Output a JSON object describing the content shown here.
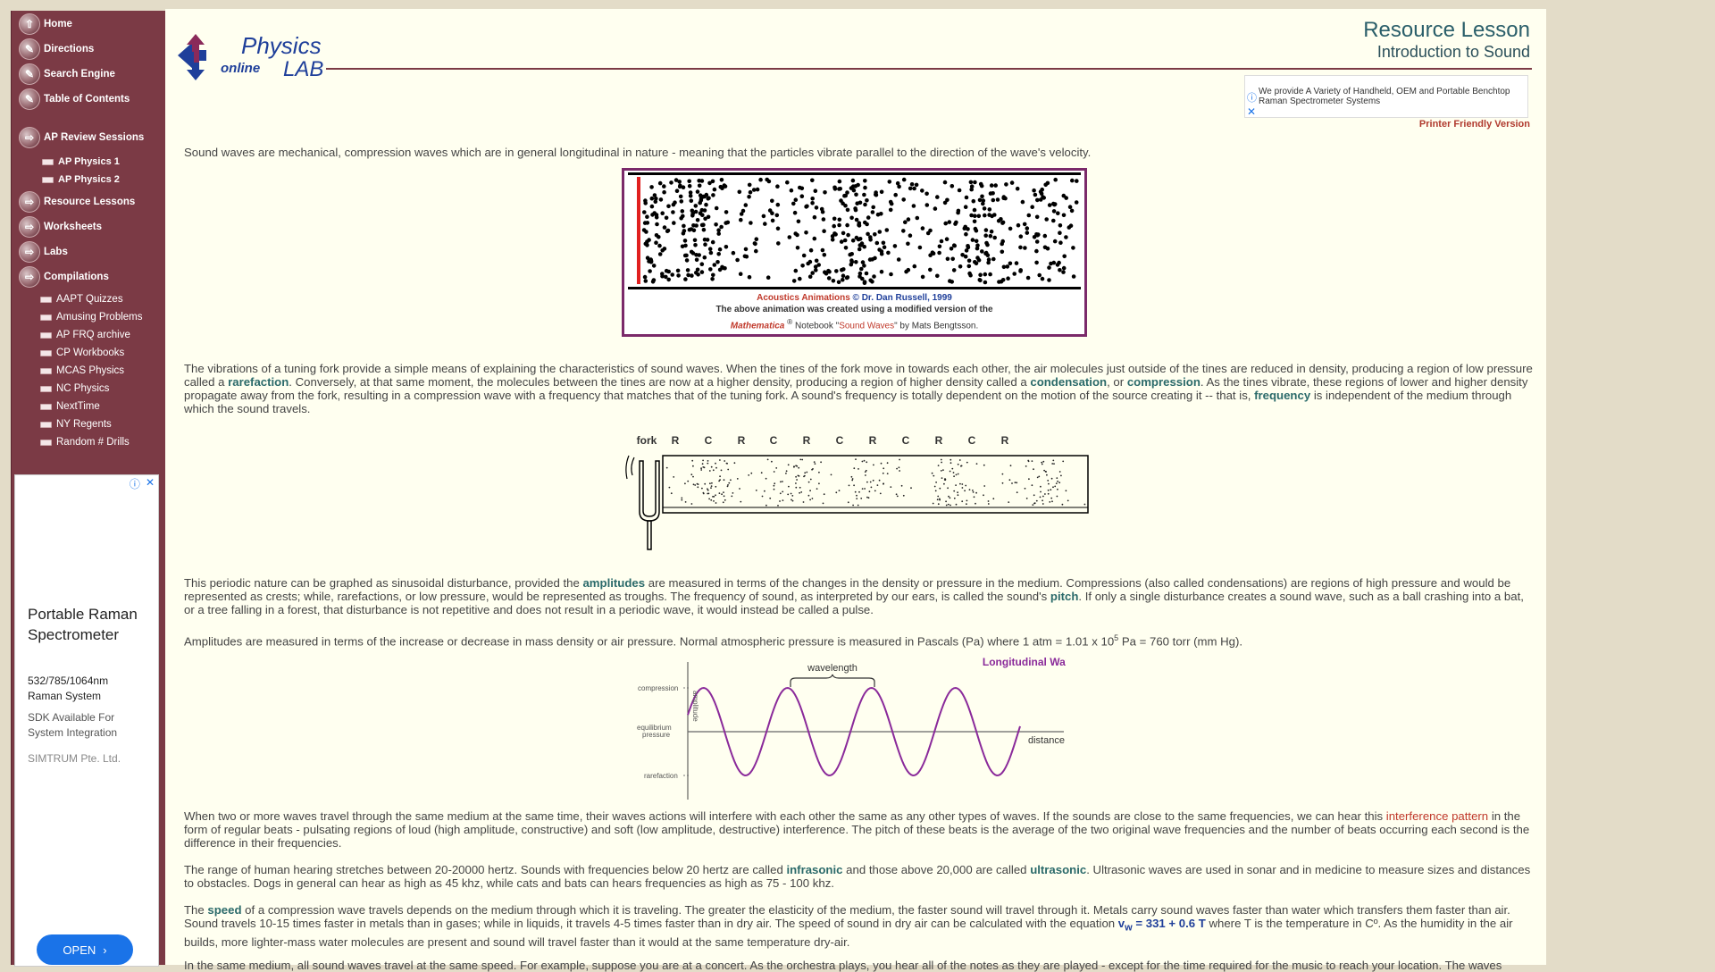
{
  "sidebar": {
    "nav": [
      {
        "label": "Home",
        "icon": "up-arrow-icon"
      },
      {
        "label": "Directions",
        "icon": "pencil-icon"
      },
      {
        "label": "Search Engine",
        "icon": "pencil-icon"
      },
      {
        "label": "Table of Contents",
        "icon": "pencil-icon"
      },
      {
        "label": "AP Review Sessions",
        "icon": "right-arrow-icon"
      },
      {
        "label": "Resource Lessons",
        "icon": "right-arrow-icon"
      },
      {
        "label": "Worksheets",
        "icon": "right-arrow-icon"
      },
      {
        "label": "Labs",
        "icon": "right-arrow-icon"
      },
      {
        "label": "Compilations",
        "icon": "right-arrow-icon"
      }
    ],
    "ap_sub": [
      "AP Physics 1",
      "AP Physics 2"
    ],
    "compilations_sub": [
      "AAPT Quizzes",
      "Amusing Problems",
      "AP FRQ archive",
      "CP Workbooks",
      "MCAS Physics",
      "NC Physics",
      "NextTime",
      "NY Regents",
      "Random # Drills"
    ]
  },
  "side_ad": {
    "title": "Portable Raman Spectrometer",
    "spec_line1": "532/785/1064nm",
    "spec_line2": "Raman System",
    "sdk_line1": "SDK Available For",
    "sdk_line2": "System Integration",
    "company": "SIMTRUM Pte. Ltd.",
    "button": "OPEN"
  },
  "header": {
    "logo_physics": "Physics",
    "logo_online": "online",
    "logo_lab": "LAB",
    "title": "Resource Lesson",
    "subtitle": "Introduction to Sound"
  },
  "top_ad": {
    "text": "We provide A Variety of Handheld, OEM and Portable Benchtop Raman Spectrometer Systems"
  },
  "printer_link": "Printer Friendly Version",
  "content": {
    "p1": "Sound waves are mechanical, compression waves which are in general longitudinal in nature - meaning that the particles vibrate parallel to the direction of the wave's velocity.",
    "anim_caption": {
      "acoustics_link": "Acoustics Animations",
      "credit": " © Dr. Dan Russell, 1999",
      "line2": "The above animation was created using a modified version of the",
      "mathematica": "Mathematica",
      "reg": "®",
      "notebook": " Notebook \"",
      "sound_waves_link": "Sound Waves",
      "by": "\" by Mats Bengtsson."
    },
    "p2": {
      "a": "The vibrations of a tuning fork provide a simple means of explaining the characteristics of sound waves. When the tines of the fork move in towards each other, the air molecules just outside of the tines are reduced in density, producing a region of low pressure called a ",
      "rarefaction": "rarefaction",
      "b": ". Conversely, at that same moment, the molecules between the tines are now at a higher density, producing a region of higher density called a ",
      "condensation": "condensation",
      "c": ", or ",
      "compression": "compression",
      "d": ". As the tines vibrate, these regions of lower and higher density propagate away from the fork, resulting in a compression wave with a frequency that matches that of the tuning fork. A sound's frequency is totally dependent on the motion of the source creating it -- that is, ",
      "frequency": "frequency",
      "e": " is independent of the medium through which the sound travels."
    },
    "fork_diagram": {
      "labels": [
        "fork",
        "R",
        "C",
        "R",
        "C",
        "R",
        "C",
        "R",
        "C",
        "R",
        "C",
        "R"
      ]
    },
    "p3": {
      "a": "This periodic nature can be graphed as sinusoidal disturbance, provided the ",
      "amplitudes": "amplitudes",
      "b": " are measured in terms of the changes in the density or pressure in the medium. Compressions (also called condensations) are regions of high pressure and would be represented as crests; while, rarefactions, or low pressure, would be represented as troughs. The frequency of sound, as interpreted by our ears, is called the sound's ",
      "pitch": "pitch",
      "c": ". If only a single disturbance creates a sound wave, such as a ball crashing into a bat, or a tree falling in a forest, that disturbance is not repetitive and does not result in a periodic wave, it would instead be called a pulse."
    },
    "p4": {
      "a": "Amplitudes are measured in terms of the increase or decrease in mass density or air pressure. Normal atmospheric pressure is measured in Pascals (Pa) where 1 atm = 1.01 x 10",
      "sup": "5",
      "b": " Pa = 760 torr (mm Hg)."
    },
    "wave_diagram": {
      "title": "Longitudinal Wave",
      "wavelength": "wavelength",
      "compression": "compression",
      "amplitude": "amplitude",
      "equilibrium1": "equilibrium",
      "equilibrium2": "pressure",
      "rarefaction": "rarefaction",
      "distance": "distance"
    },
    "p5": {
      "a": "When two or more waves travel through the same medium at the same time, their waves actions will interfere with each other the same as any other types of waves.  If the sounds are close to the same frequencies, we can hear this ",
      "interference": "interference pattern",
      "b": " in the form of regular beats - pulsating regions of loud (high amplitude, constructive) and soft (low amplitude, destructive) interference. The pitch of these beats is the average of the two original wave frequencies and the number of beats occurring each second is the difference in their frequencies."
    },
    "p6": {
      "a": "The range of human hearing stretches between 20-20000 hertz. Sounds with frequencies below 20 hertz are called ",
      "infrasonic": "infrasonic",
      "b": " and those above 20,000 are called ",
      "ultrasonic": "ultrasonic",
      "c": ". Ultrasonic waves are used in sonar and in medicine to measure sizes and distances to obstacles. Dogs in general can hear as high as 45 khz, while cats and bats can hears frequencies as high as 75 - 100 khz."
    },
    "p7": {
      "a": "The ",
      "speed": "speed",
      "b": " of a compression wave travels depends on the medium through which it is traveling. The greater the elasticity of the medium, the faster sound will travel through it. Metals carry sound waves faster than water which transfers them faster than air. Sound travels 10-15 times faster in metals than in gases; while in liquids, it travels 4-5 times faster than in dry air. The speed of sound in dry air can be calculated with the equation ",
      "eq_v": "v",
      "eq_sub": "w",
      "eq_rest": " = 331 + 0.6 T",
      "c": " where T is the temperature in Cº. As the humidity in the air builds, more lighter-mass water molecules are present and sound will travel faster than it would at the same temperature dry-air."
    },
    "p8": "In the same medium, all sound waves travel at the same speed. For example, suppose you are at a concert. As the orchestra plays, you hear all of the notes as they are played - except for the time required for the music to reach your location. The waves"
  },
  "colors": {
    "sidebar": "#7b3a45",
    "page_bg": "#fffff0",
    "keyword": "#2b6a6a",
    "link_red": "#c0392b",
    "logo_blue": "#1f3f9a"
  }
}
